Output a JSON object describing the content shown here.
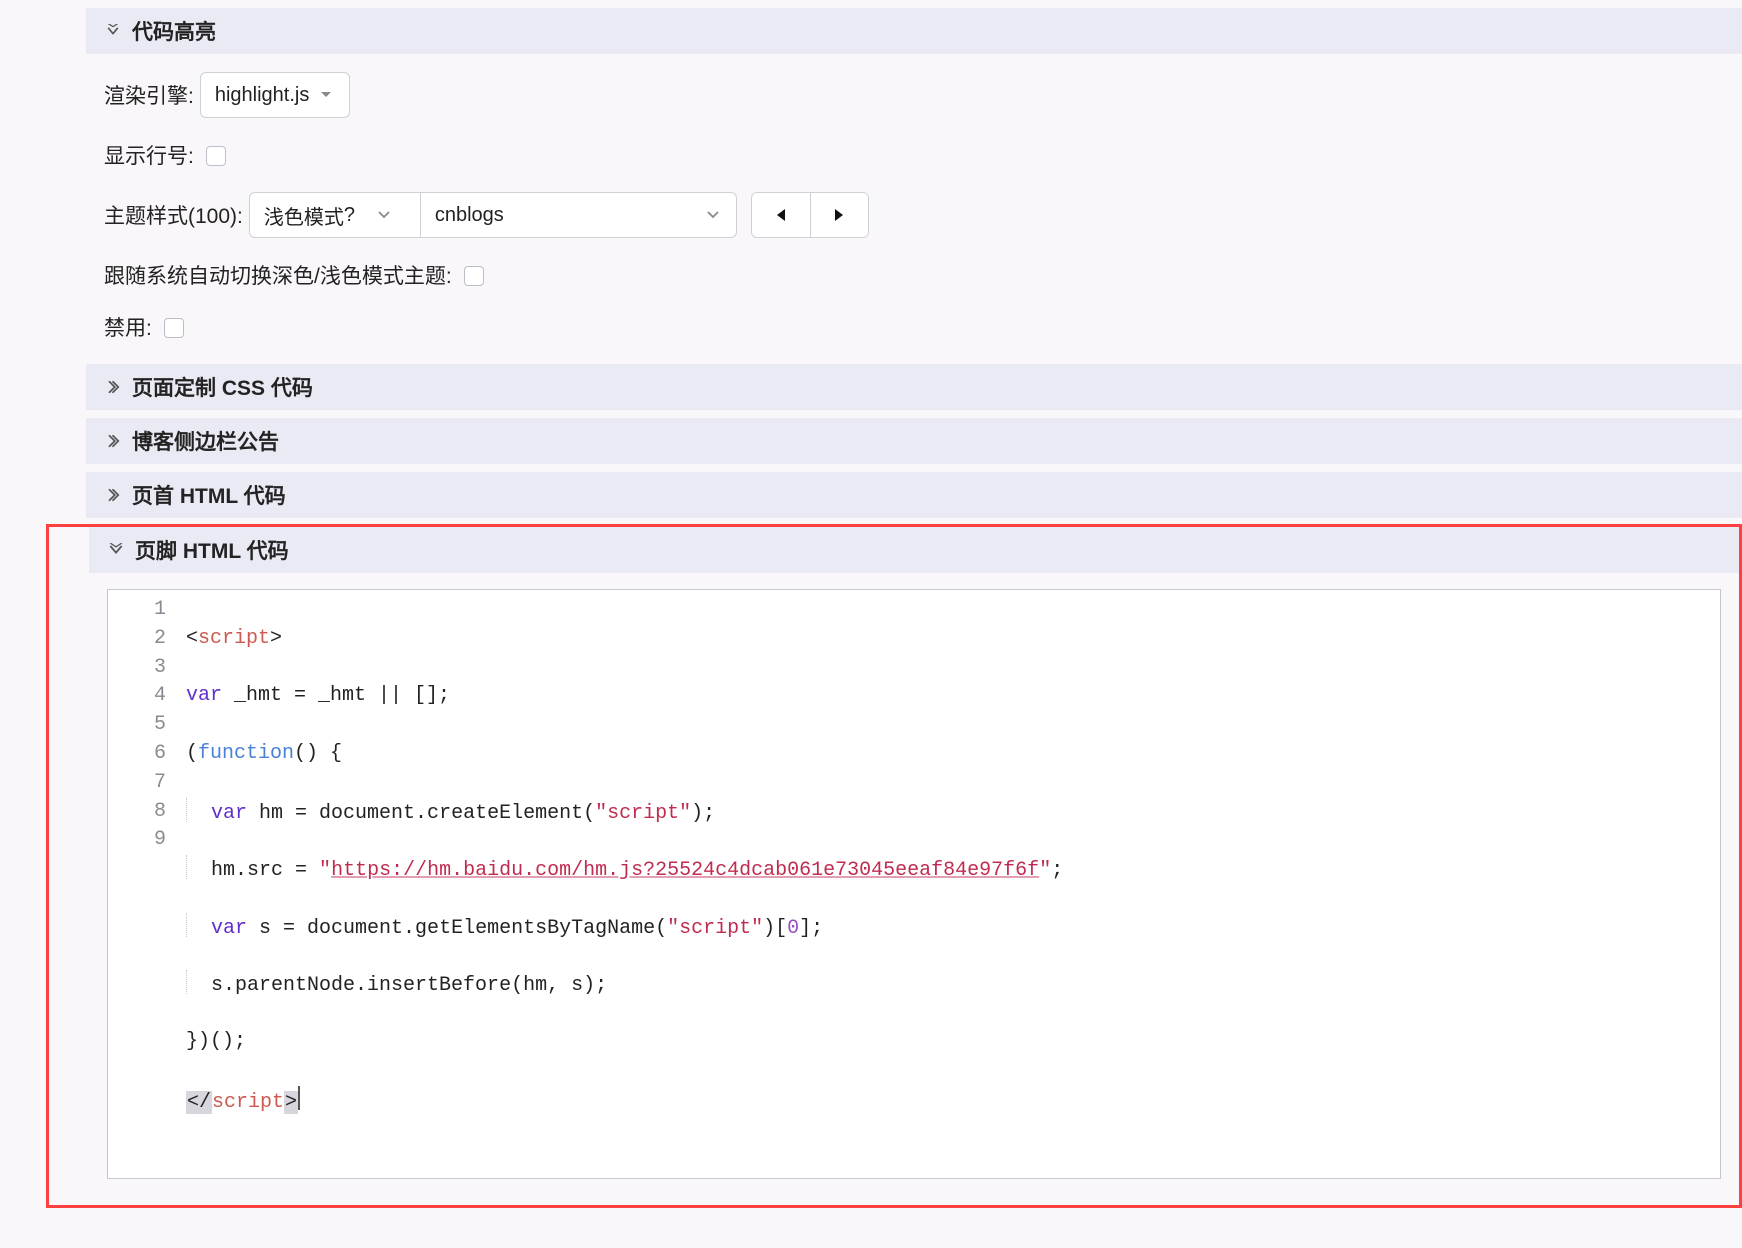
{
  "sections": {
    "highlight": {
      "title": "代码高亮"
    },
    "css": {
      "title": "页面定制 CSS 代码"
    },
    "sidebar": {
      "title": "博客侧边栏公告"
    },
    "headerHtml": {
      "title": "页首 HTML 代码"
    },
    "footerHtml": {
      "title": "页脚 HTML 代码"
    }
  },
  "highlight_panel": {
    "engine_label": "渲染引擎:",
    "engine_value": "highlight.js",
    "line_no_label": "显示行号:",
    "theme_label": "主题样式(100):",
    "mode_value": "浅色模式",
    "theme_value": "cnblogs",
    "auto_switch_label": "跟随系统自动切换深色/浅色模式主题:",
    "disable_label": "禁用:"
  },
  "code": {
    "line_count": 9,
    "l1": {
      "a": "<",
      "b": "script",
      "c": ">"
    },
    "l2": {
      "kw": "var",
      "rest": " _hmt = _hmt || [];"
    },
    "l3": {
      "a": "(",
      "fn": "function",
      "b": "() {"
    },
    "l4": {
      "pad": "  ",
      "kw": "var",
      "mid": " hm = document.createElement(",
      "str": "\"script\"",
      "end": ");"
    },
    "l5": {
      "pad": "  ",
      "a": "hm.src = ",
      "q1": "\"",
      "url": "https://hm.baidu.com/hm.js?25524c4dcab061e73045eeaf84e97f6f",
      "q2": "\"",
      "end": ";"
    },
    "l6": {
      "pad": "  ",
      "kw": "var",
      "mid": " s = document.getElementsByTagName(",
      "str": "\"script\"",
      "after": ")[",
      "num": "0",
      "end": "];"
    },
    "l7": {
      "pad": "  ",
      "text": "s.parentNode.insertBefore(hm, s);"
    },
    "l8": {
      "text": "})();"
    },
    "l9": {
      "a": "</",
      "b": "script",
      "c": ">"
    }
  }
}
